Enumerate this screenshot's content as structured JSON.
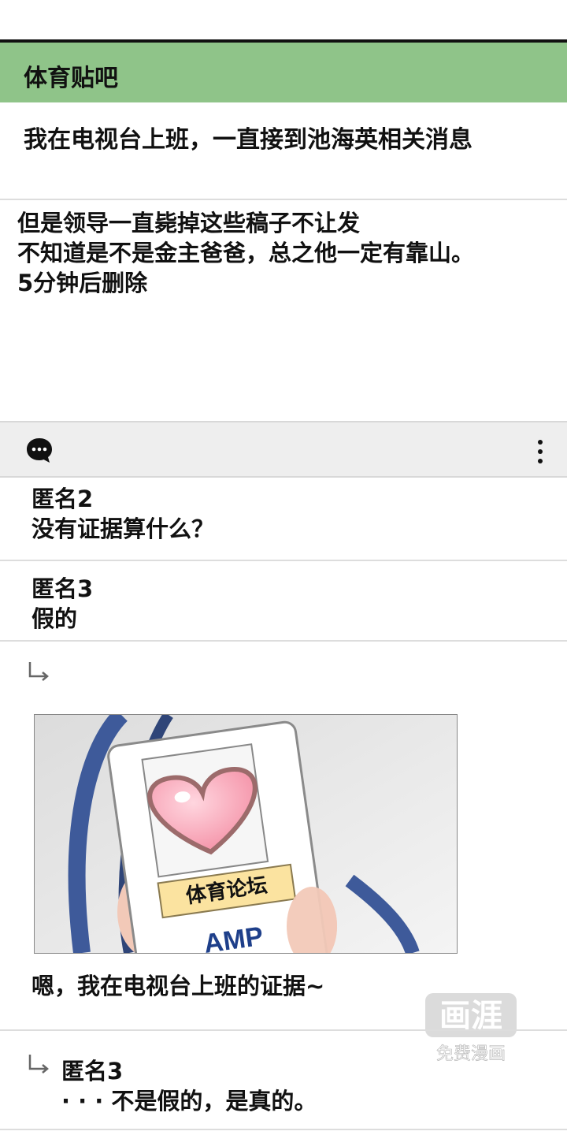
{
  "forum": {
    "name": "体育贴吧"
  },
  "post": {
    "title": "我在电视台上班，一直接到池海英相关消息",
    "body": [
      "但是领导一直毙掉这些稿子不让发",
      "不知道是不是金主爸爸，总之他一定有靠山。",
      "5分钟后删除"
    ]
  },
  "toolbar": {
    "chat_icon": "chat-bubble-icon",
    "more_icon": "more-vertical-icon"
  },
  "comments": [
    {
      "author": "匿名2",
      "text": "没有证据算什么？"
    },
    {
      "author": "匿名3",
      "text": "假的"
    }
  ],
  "reply_post": {
    "image": {
      "badge_text": "体育论坛",
      "logo_text": "AMP"
    },
    "caption": "嗯，我在电视台上班的证据~"
  },
  "watermark": {
    "logo": "画涯",
    "subtitle": "免费漫画"
  },
  "reply_comment": {
    "author": "匿名3",
    "text": "· · · 不是假的，是真的。"
  },
  "colors": {
    "header_bg": "#8fc489",
    "toolbar_bg": "#eeeeee"
  }
}
